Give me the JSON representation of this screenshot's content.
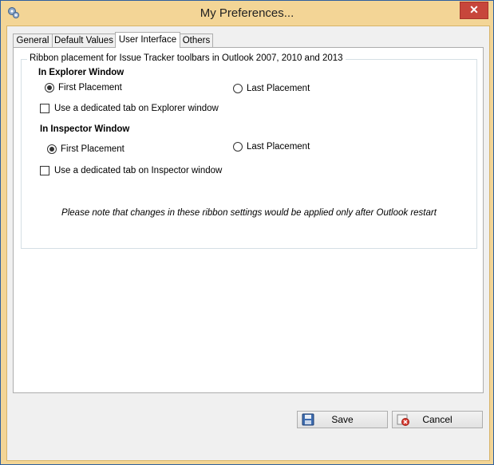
{
  "window": {
    "title": "My Preferences...",
    "close_glyph": "✕",
    "icons": {
      "app": "preferences-gear-icon",
      "close": "close-icon"
    },
    "colors": {
      "frame": "#f3d596",
      "close": "#c7463b",
      "panel": "#ffffff"
    }
  },
  "tabs": [
    {
      "label": "General",
      "active": false
    },
    {
      "label": "Default Values",
      "active": false
    },
    {
      "label": "User Interface",
      "active": true
    },
    {
      "label": "Others",
      "active": false
    }
  ],
  "ribbon_group": {
    "legend": "Ribbon placement for Issue Tracker toolbars in Outlook 2007, 2010 and 2013",
    "explorer": {
      "heading": "In Explorer Window",
      "first_placement": "First Placement",
      "last_placement": "Last Placement",
      "selected": "first",
      "dedicated_tab": "Use a dedicated tab on Explorer window",
      "dedicated_tab_checked": false
    },
    "inspector": {
      "heading": "In Inspector Window",
      "first_placement": "First Placement",
      "last_placement": "Last Placement",
      "selected": "first",
      "dedicated_tab": "Use a dedicated tab on Inspector window",
      "dedicated_tab_checked": false
    },
    "note": "Please note that changes in these ribbon settings would be applied only after Outlook restart"
  },
  "buttons": {
    "save": {
      "label": "Save",
      "icon": "save-disk-icon"
    },
    "cancel": {
      "label": "Cancel",
      "icon": "cancel-icon"
    }
  }
}
